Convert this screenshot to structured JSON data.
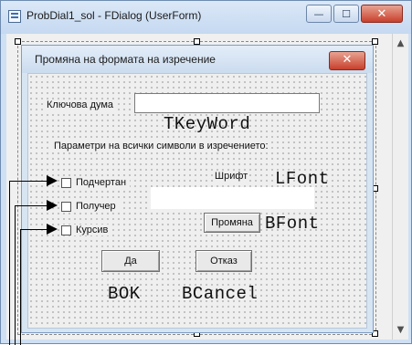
{
  "window": {
    "title": "ProbDial1_sol - FDialog (UserForm)",
    "min_glyph": "—",
    "max_glyph": "☐",
    "close_glyph": "✕"
  },
  "form": {
    "title": "Промяна на формата на изречение",
    "close_glyph": "✕"
  },
  "controls": {
    "keyword_label": "Ключова дума",
    "keyword_value": "",
    "keyword_name": "TKeyWord",
    "params_label": "Параметри на всички символи в изречението:",
    "font_label": "Шрифт",
    "font_label_name": "LFont",
    "font_value": "",
    "checkboxes": [
      {
        "label": "Подчертан",
        "checked": false
      },
      {
        "label": "Получер",
        "checked": false
      },
      {
        "label": "Курсив",
        "checked": false
      }
    ],
    "change_button": "Промяна",
    "change_button_name": "BFont",
    "ok_button": "Да",
    "ok_button_name": "BOK",
    "cancel_button": "Отказ",
    "cancel_button_name": "BCancel"
  },
  "scrollbar": {
    "up_glyph": "▲",
    "down_glyph": "▼"
  }
}
